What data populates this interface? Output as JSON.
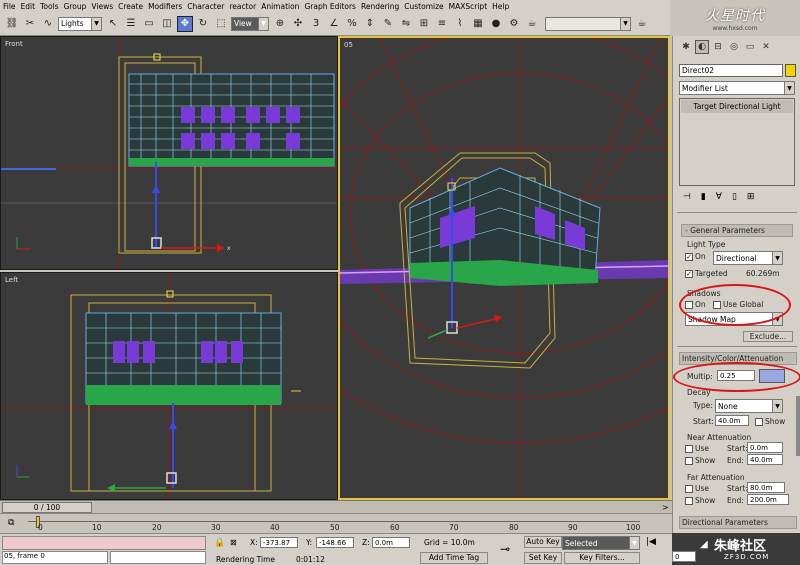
{
  "menu": [
    "File",
    "Edit",
    "Tools",
    "Group",
    "Views",
    "Create",
    "Modifiers",
    "Character",
    "reactor",
    "Animation",
    "Graph Editors",
    "Rendering",
    "Customize",
    "MAXScript",
    "Help"
  ],
  "toolbar": {
    "selection_filter": "Lights",
    "ref_coord": "View"
  },
  "logo": {
    "title": "火星时代",
    "url": "www.hxsd.com"
  },
  "viewports": {
    "front": "Front",
    "left": "Left",
    "camera": "05"
  },
  "panel": {
    "object_name": "Direct02",
    "modifier_list": "Modifier List",
    "stack_item": "Target Directional Light",
    "general_title": "General Parameters",
    "light_type_label": "Light Type",
    "on_label": "On",
    "light_type_value": "Directional",
    "targeted_label": "Targeted",
    "target_distance": "60.269m",
    "shadows_label": "Shadows",
    "shadows_on": "On",
    "use_global": "Use Global",
    "shadow_type": "Shadow Map",
    "exclude_btn": "Exclude...",
    "intensity_title": "Intensity/Color/Attenuation",
    "multiplier_label": "Multip:",
    "multiplier_value": "0.25",
    "light_color": "#9aa6de",
    "decay_label": "Decay",
    "decay_type_label": "Type:",
    "decay_type_value": "None",
    "decay_start_label": "Start:",
    "decay_start_value": "40.0m",
    "decay_show": "Show",
    "near_atten_title": "Near Attenuation",
    "near_use": "Use",
    "near_start_label": "Start:",
    "near_start_value": "0.0m",
    "near_show": "Show",
    "near_end_label": "End:",
    "near_end_value": "40.0m",
    "far_atten_title": "Far Attenuation",
    "far_use": "Use",
    "far_start_label": "Start:",
    "far_start_value": "80.0m",
    "far_show": "Show",
    "far_end_label": "End:",
    "far_end_value": "200.0m",
    "directional_title": "Directional Parameters"
  },
  "timeline": {
    "slider_label": "0 / 100",
    "ticks": [
      "0",
      "10",
      "20",
      "30",
      "40",
      "50",
      "60",
      "70",
      "80",
      "90",
      "100"
    ]
  },
  "status": {
    "listener": "05, frame 0",
    "rendering_time_label": "Rendering Time",
    "rendering_time": "0:01:12",
    "x_label": "X:",
    "x_value": "-373.87",
    "y_label": "Y:",
    "y_value": "-148.66",
    "z_label": "Z:",
    "z_value": "0.0m",
    "grid": "Grid = 10.0m",
    "add_time_tag": "Add Time Tag",
    "auto_key": "Auto Key",
    "set_key": "Set Key",
    "selected": "Selected",
    "key_filters": "Key Filters...",
    "frame_value": "0"
  },
  "watermark": {
    "brand": "朱峰社区",
    "url": "ZF3D.COM"
  }
}
